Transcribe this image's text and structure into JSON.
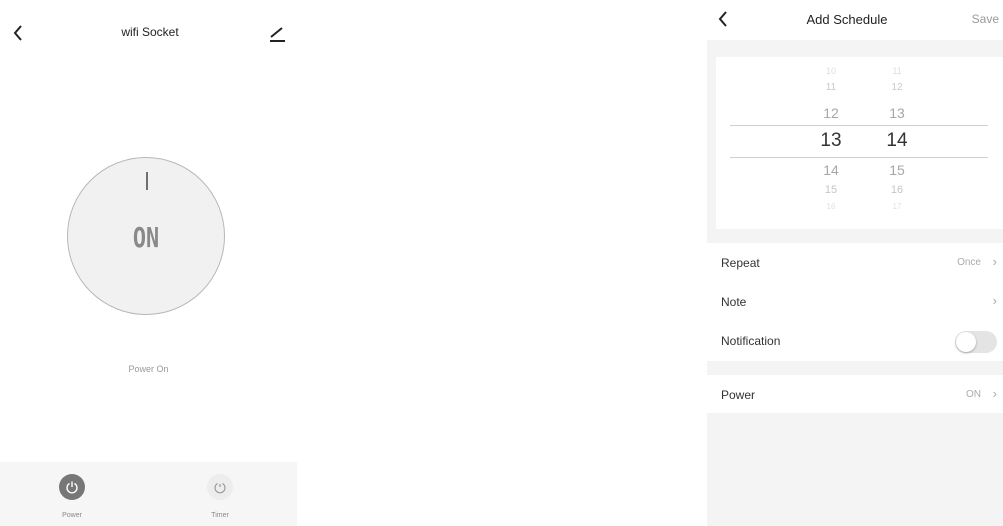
{
  "left": {
    "title": "wifi Socket",
    "dial_label": "ON",
    "status": "Power On",
    "tabs": [
      {
        "label": "Power",
        "icon": "power-icon"
      },
      {
        "label": "Timer",
        "icon": "timer-icon"
      }
    ]
  },
  "right": {
    "title": "Add Schedule",
    "save_label": "Save",
    "picker": {
      "hours": [
        "10",
        "11",
        "12",
        "13",
        "14",
        "15",
        "16"
      ],
      "minutes": [
        "11",
        "12",
        "13",
        "14",
        "15",
        "16",
        "17"
      ],
      "selected_hour": "13",
      "selected_minute": "14"
    },
    "rows": {
      "repeat": {
        "label": "Repeat",
        "value": "Once"
      },
      "note": {
        "label": "Note",
        "value": ""
      },
      "notification": {
        "label": "Notification",
        "enabled": false
      },
      "power": {
        "label": "Power",
        "value": "ON"
      }
    }
  },
  "colors": {
    "dial_fill": "#f1f1f1",
    "toggle_off": "#e4e4e4",
    "tab_active": "#777777"
  }
}
